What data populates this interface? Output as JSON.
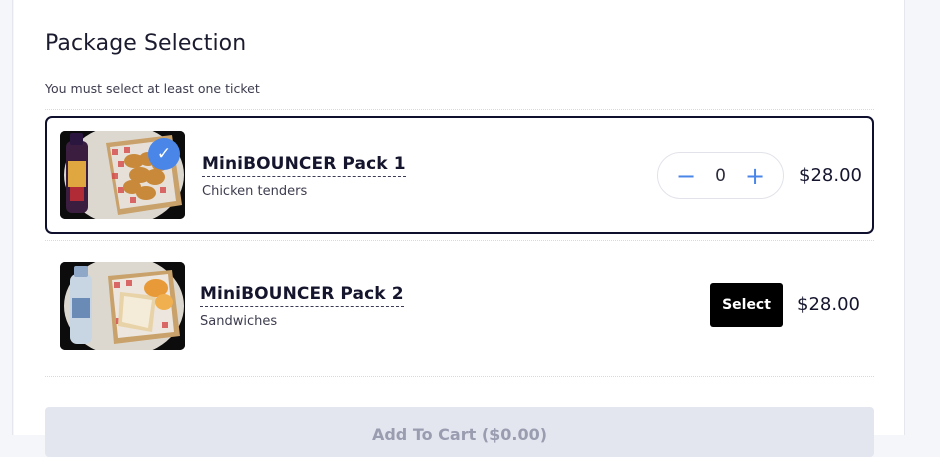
{
  "section": {
    "title": "Package Selection",
    "subtitle": "You must select at least one ticket"
  },
  "packages": [
    {
      "name": "MiniBOUNCER Pack 1",
      "description": "Chicken tenders",
      "price": "$28.00",
      "quantity": "0",
      "selected": true,
      "check_glyph": "✓",
      "minus_glyph": "−",
      "plus_glyph": "+"
    },
    {
      "name": "MiniBOUNCER Pack 2",
      "description": "Sandwiches",
      "price": "$28.00",
      "select_label": "Select",
      "selected": false
    }
  ],
  "cart": {
    "label": "Add To Cart ($0.00)"
  },
  "colors": {
    "accent": "#4a86e8",
    "selected_border": "#0f0f2e",
    "select_button": "#000000",
    "cart_button_bg": "#e4e6ef"
  }
}
